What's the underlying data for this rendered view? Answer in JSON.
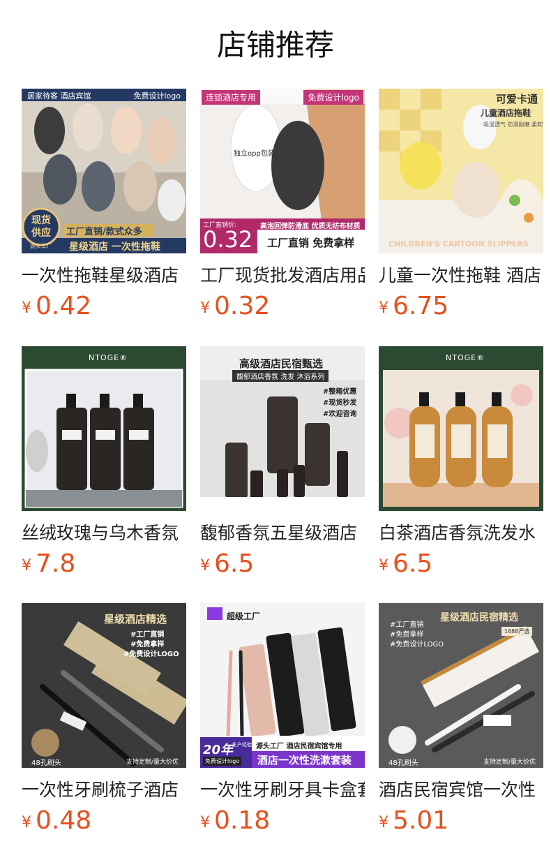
{
  "header": {
    "title": "店铺推荐"
  },
  "products": [
    {
      "name": "一次性拖鞋星级酒店",
      "currency": "¥",
      "price": "0.42",
      "img": {
        "tag_left": "居家待客 酒店宾馆",
        "tag_right": "免费设计logo",
        "seal1": "现货",
        "seal2": "供应",
        "seal3": "源头工厂",
        "line1": "工厂直销/款式众多",
        "line2": "星级酒店 一次性拖鞋"
      }
    },
    {
      "name": "工厂现货批发酒店用品",
      "currency": "¥",
      "price": "0.32",
      "img": {
        "tag_left": "连锁酒店专用",
        "tag_right": "免费设计logo",
        "pack": "独立opp包装",
        "sub": "工厂直销价:",
        "big": "0.32",
        "feat": "高泡回弹防滑底  优质无纺布材质",
        "line": "工厂直销 免费拿样"
      }
    },
    {
      "name": "儿童一次性拖鞋 酒店",
      "currency": "¥",
      "price": "6.75",
      "img": {
        "t1": "可爱卡通",
        "t2": "儿童酒店拖鞋",
        "t3": "吸湿透气  防滑耐磨  柔软舒适",
        "bottom": "CHILDREN'S CARTOON SLIPPERS"
      }
    },
    {
      "name": "丝绒玫瑰与乌木香氛",
      "currency": "¥",
      "price": "7.8",
      "img": {
        "brand": "NTOGE®"
      }
    },
    {
      "name": "馥郁香氛五星级酒店",
      "currency": "¥",
      "price": "6.5",
      "img": {
        "t1": "高级酒店民宿甄选",
        "t2": "馥郁酒店香氛 洗发 沐浴系列",
        "h1": "#整箱优惠",
        "h2": "#现货秒发",
        "h3": "#欢迎咨询"
      }
    },
    {
      "name": "白茶酒店香氛洗发水",
      "currency": "¥",
      "price": "6.5",
      "img": {
        "brand": "NTOGE®"
      }
    },
    {
      "name": "一次性牙刷梳子酒店",
      "currency": "¥",
      "price": "0.48",
      "img": {
        "t1": "星级酒店精选",
        "h1": "#工厂直销",
        "h2": "#免费拿样",
        "h3": "#免费设计LOGO",
        "bl": "48孔刷头",
        "br": "支持定制/量大价优"
      }
    },
    {
      "name": "一次性牙刷牙具卡盒套",
      "currency": "¥",
      "price": "0.18",
      "img": {
        "tag": "超级工厂",
        "years": "20年",
        "yearsub": "生产经验",
        "logo": "免费设计logo",
        "l1": "源头工厂  酒店民宿宾馆专用",
        "l2": "酒店一次性洗漱套装"
      }
    },
    {
      "name": "酒店民宿宾馆一次性",
      "currency": "¥",
      "price": "5.01",
      "img": {
        "t1": "星级酒店民宿精选",
        "h1": "#工厂直销",
        "h2": "#免费拿样",
        "h3": "#免费设计LOGO",
        "tag": "1688严选",
        "bl": "48孔刷头",
        "br": "支持定制/量大价优"
      }
    }
  ],
  "colors": {
    "price": "#e8501c",
    "title": "#111111"
  }
}
